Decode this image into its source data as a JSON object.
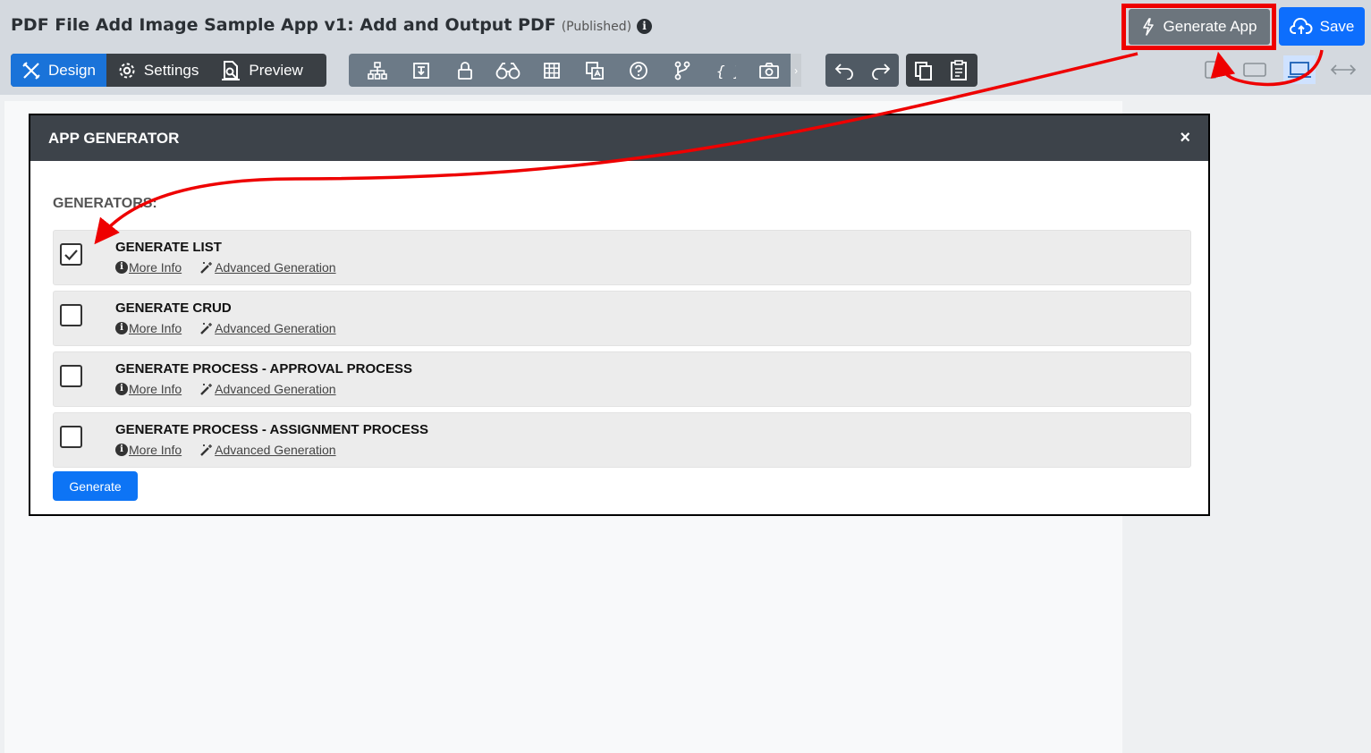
{
  "header": {
    "app_title": "PDF File Add Image Sample App v1: Add and Output PDF",
    "status": "(Published)",
    "generate_app_label": "Generate App",
    "save_label": "Save"
  },
  "mode_tabs": [
    {
      "label": "Design",
      "icon": "design-icon",
      "active": true
    },
    {
      "label": "Settings",
      "icon": "gear-icon",
      "active": false
    },
    {
      "label": "Preview",
      "icon": "preview-icon",
      "active": false
    }
  ],
  "toolbar_icons": [
    "tree-icon",
    "properties-icon",
    "lock-icon",
    "binoculars-icon",
    "table-icon",
    "translate-icon",
    "help-icon",
    "branch-icon",
    "braces-icon",
    "camera-icon"
  ],
  "view_icons": [
    "phone-view-icon",
    "tablet-view-icon",
    "desktop-view-icon",
    "fullwidth-view-icon"
  ],
  "modal": {
    "title": "APP GENERATOR",
    "close": "×",
    "section_title": "GENERATORS:",
    "more_info": "More Info",
    "advanced": "Advanced Generation",
    "generators": [
      {
        "name": "GENERATE LIST",
        "checked": true
      },
      {
        "name": "GENERATE CRUD",
        "checked": false
      },
      {
        "name": "GENERATE PROCESS - APPROVAL PROCESS",
        "checked": false
      },
      {
        "name": "GENERATE PROCESS - ASSIGNMENT PROCESS",
        "checked": false
      }
    ],
    "generate_button": "Generate"
  },
  "colors": {
    "accent": "#0d6efd",
    "annotation": "#ee0000",
    "modal_header": "#3d434a"
  }
}
